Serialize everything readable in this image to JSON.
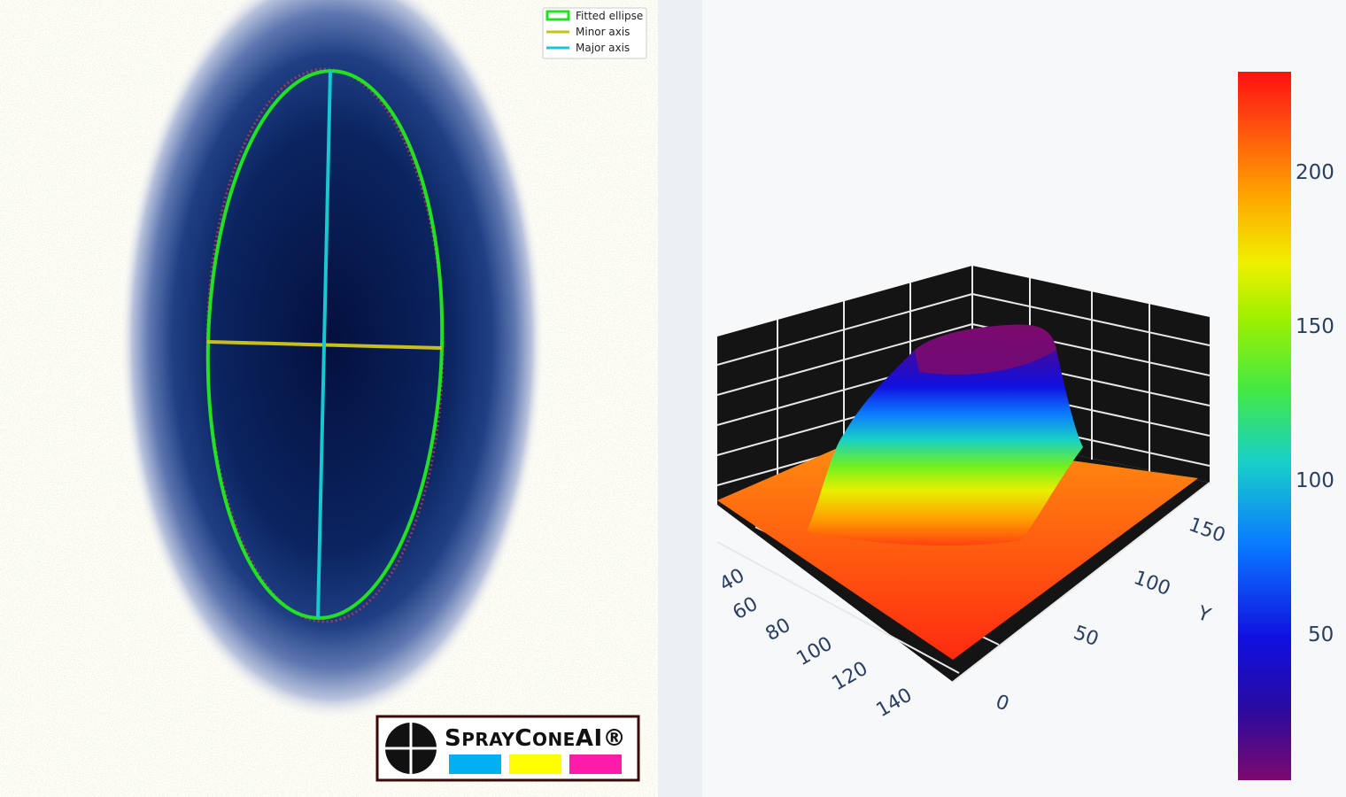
{
  "left_plot": {
    "legend": [
      {
        "label": "Fitted ellipse",
        "color": "#22e022"
      },
      {
        "label": "Minor axis",
        "color": "#c8c018"
      },
      {
        "label": "Major axis",
        "color": "#18c8d0"
      }
    ],
    "logo": {
      "text_s": "S",
      "text_pray": "PRAY",
      "text_c": "C",
      "text_one": "ONE",
      "text_ai": "AI®",
      "swatches": [
        "#00b0f0",
        "#ffff00",
        "#ff1ca8"
      ]
    }
  },
  "right_plot": {
    "chart_data": {
      "type": "surface",
      "x_ticks": [
        "40",
        "60",
        "80",
        "100",
        "120",
        "140"
      ],
      "y_ticks": [
        "0",
        "50",
        "100",
        "150"
      ],
      "y_axis_label": "Y",
      "colorscale": "jet",
      "colorbar_ticks": [
        "200",
        "150",
        "100",
        "50"
      ],
      "z_range": [
        0,
        230
      ],
      "background_colors": {
        "plane": "#141414",
        "grid": "#e8e8e8"
      }
    }
  }
}
